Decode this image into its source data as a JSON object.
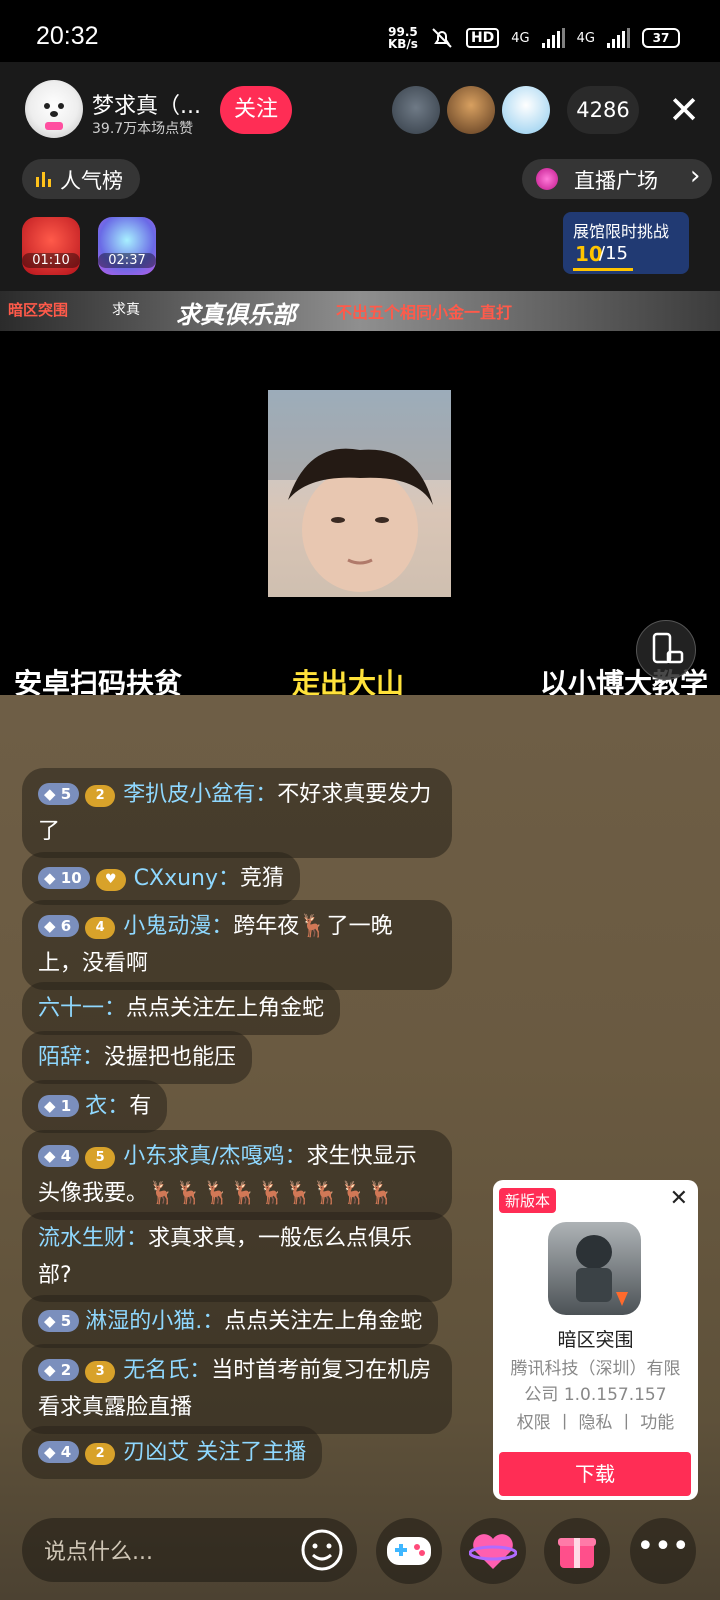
{
  "status_bar": {
    "time": "20:32",
    "net_speed_value": "99.5",
    "net_speed_unit": "KB/s",
    "hd_label": "HD",
    "sim1_label": "4G",
    "sim2_label": "4G",
    "battery": "37"
  },
  "host": {
    "name": "梦求真（...",
    "likes": "39.7万本场点赞",
    "follow_label": "关注"
  },
  "viewers": {
    "count": "4286"
  },
  "top_row": {
    "rank_label": "人气榜",
    "plaza_label": "直播广场"
  },
  "gifts": [
    {
      "timer": "01:10"
    },
    {
      "timer": "02:37"
    }
  ],
  "challenge": {
    "title": "展馆限时挑战",
    "current": "10",
    "total": "/15"
  },
  "banner": {
    "left": "暗区突围",
    "center": "求真",
    "title": "求真俱乐部",
    "slogan": "不出五个相同小金一直打"
  },
  "video": {
    "captions": [
      "安卓扫码扶贫",
      "走出大山",
      "以小博大教学"
    ]
  },
  "chat": [
    {
      "level": "5",
      "fan": "2",
      "user": "李扒皮小盆有：",
      "text": "不好求真要发力了"
    },
    {
      "level": "10",
      "fan": "",
      "user": "CXxuny：",
      "text": "竞猜"
    },
    {
      "level": "6",
      "fan": "4",
      "user": "小鬼动漫：",
      "text": "跨年夜🦌了一晚上，没看啊"
    },
    {
      "level": "",
      "fan": "",
      "user": "六十一：",
      "text": "点点关注左上角金蛇"
    },
    {
      "level": "",
      "fan": "",
      "user": "陌辞：",
      "text": "没握把也能压"
    },
    {
      "level": "1",
      "fan": "",
      "user": "衣：",
      "text": "有"
    },
    {
      "level": "4",
      "fan": "5",
      "user": "小东求真/杰嘎鸡：",
      "text": "求生快显示头像我要。🦌🦌🦌🦌🦌🦌🦌🦌🦌"
    },
    {
      "level": "",
      "fan": "",
      "user": "流水生财：",
      "text": "求真求真，一般怎么点俱乐部?"
    },
    {
      "level": "5",
      "fan": "",
      "user": "淋湿的小猫.：",
      "text": "点点关注左上角金蛇"
    },
    {
      "level": "2",
      "fan": "3",
      "user": "无名氏：",
      "text": "当时首考前复习在机房看求真露脸直播"
    },
    {
      "level": "4",
      "fan": "2",
      "user": "刃凶艾 关注了主播",
      "text": ""
    }
  ],
  "ad": {
    "badge": "新版本",
    "name": "暗区突围",
    "developer": "腾讯科技（深圳）有限公司 1.0.157.157",
    "links": "权限 丨 隐私 丨 功能",
    "download": "下载"
  },
  "bottom_bar": {
    "input_placeholder": "说点什么..."
  }
}
